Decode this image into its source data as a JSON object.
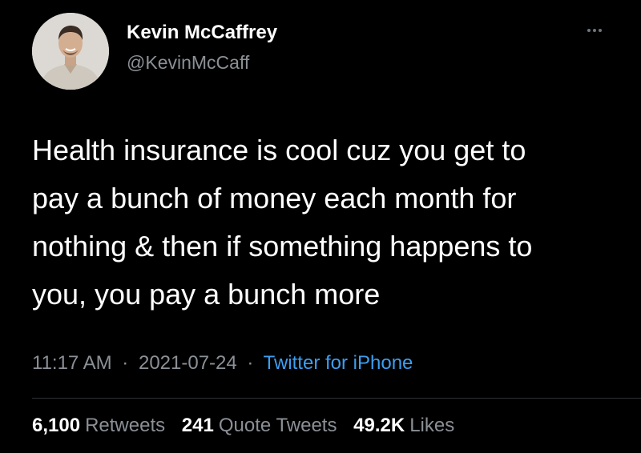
{
  "author": {
    "name": "Kevin McCaffrey",
    "handle": "@KevinMcCaff"
  },
  "tweet": {
    "text_lines": [
      "Health insurance is cool cuz you get to",
      "pay a bunch of money each month for",
      "nothing & then if something happens to",
      "you, you pay a bunch more"
    ],
    "time": "11:17 AM",
    "date": "2021-07-24",
    "separator": "·",
    "source": "Twitter for iPhone"
  },
  "stats": {
    "retweets": {
      "count": "6,100",
      "label": "Retweets"
    },
    "quotes": {
      "count": "241",
      "label": "Quote Tweets"
    },
    "likes": {
      "count": "49.2K",
      "label": "Likes"
    }
  },
  "icons": {
    "more": "more-horizontal-icon"
  },
  "colors": {
    "background": "#000000",
    "primary_text": "#ffffff",
    "secondary_text": "#8b9096",
    "link": "#3d9ef0",
    "divider": "#2f3336"
  }
}
